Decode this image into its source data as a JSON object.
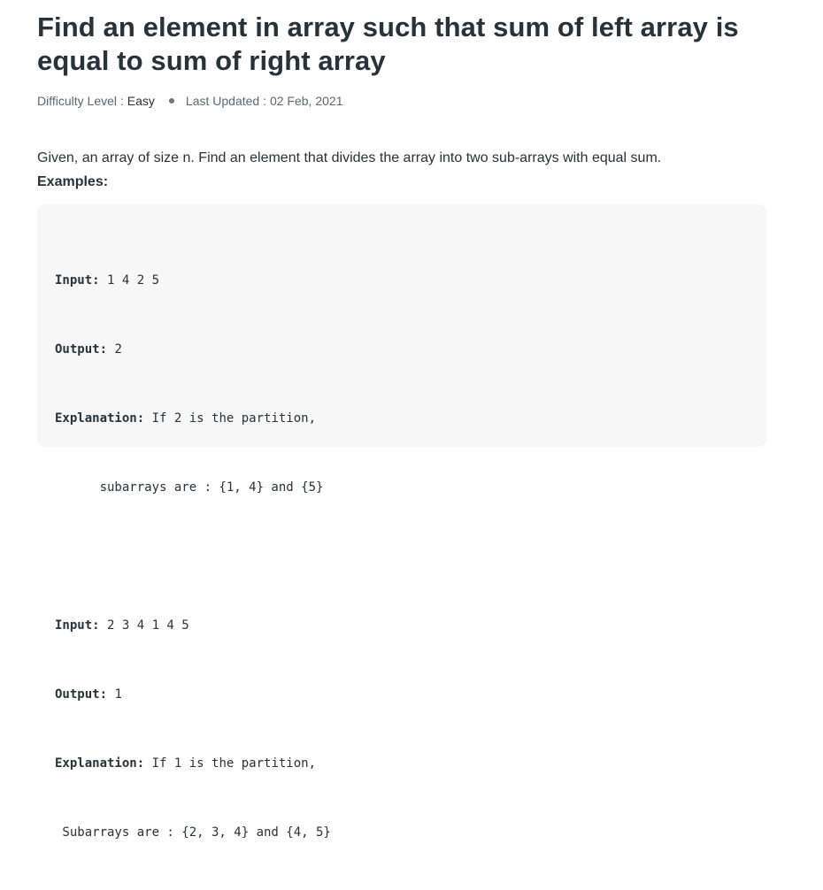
{
  "article": {
    "title": "Find an element in array such that sum of left array is equal to sum of right array",
    "difficulty_label": "Difficulty Level :",
    "difficulty_value": "Easy",
    "updated_label": "Last Updated :",
    "updated_value": "02 Feb, 2021",
    "intro": "Given, an array of size n. Find an element that divides the array into two sub-arrays with equal sum.",
    "examples_heading": "Examples:"
  },
  "examples": [
    {
      "input_label": "Input:",
      "input_value": " 1 4 2 5",
      "output_label": "Output:",
      "output_value": " 2",
      "explanation_label": "Explanation:",
      "explanation_value": " If 2 is the partition,",
      "explanation_cont": "      subarrays are : {1, 4} and {5}"
    },
    {
      "input_label": "Input:",
      "input_value": " 2 3 4 1 4 5",
      "output_label": "Output:",
      "output_value": " 1",
      "explanation_label": "Explanation:",
      "explanation_value": " If 1 is the partition,",
      "explanation_cont": " Subarrays are : {2, 3, 4} and {4, 5}"
    }
  ]
}
